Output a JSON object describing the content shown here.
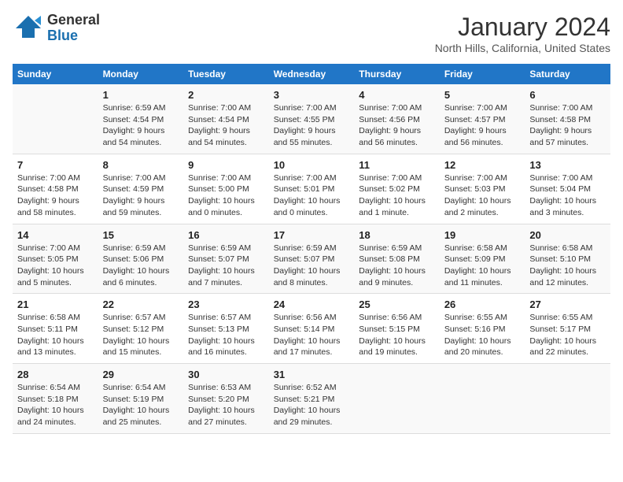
{
  "header": {
    "logo_line1": "General",
    "logo_line2": "Blue",
    "month_year": "January 2024",
    "location": "North Hills, California, United States"
  },
  "weekdays": [
    "Sunday",
    "Monday",
    "Tuesday",
    "Wednesday",
    "Thursday",
    "Friday",
    "Saturday"
  ],
  "weeks": [
    [
      {
        "day": "",
        "info": ""
      },
      {
        "day": "1",
        "info": "Sunrise: 6:59 AM\nSunset: 4:54 PM\nDaylight: 9 hours\nand 54 minutes."
      },
      {
        "day": "2",
        "info": "Sunrise: 7:00 AM\nSunset: 4:54 PM\nDaylight: 9 hours\nand 54 minutes."
      },
      {
        "day": "3",
        "info": "Sunrise: 7:00 AM\nSunset: 4:55 PM\nDaylight: 9 hours\nand 55 minutes."
      },
      {
        "day": "4",
        "info": "Sunrise: 7:00 AM\nSunset: 4:56 PM\nDaylight: 9 hours\nand 56 minutes."
      },
      {
        "day": "5",
        "info": "Sunrise: 7:00 AM\nSunset: 4:57 PM\nDaylight: 9 hours\nand 56 minutes."
      },
      {
        "day": "6",
        "info": "Sunrise: 7:00 AM\nSunset: 4:58 PM\nDaylight: 9 hours\nand 57 minutes."
      }
    ],
    [
      {
        "day": "7",
        "info": "Sunrise: 7:00 AM\nSunset: 4:58 PM\nDaylight: 9 hours\nand 58 minutes."
      },
      {
        "day": "8",
        "info": "Sunrise: 7:00 AM\nSunset: 4:59 PM\nDaylight: 9 hours\nand 59 minutes."
      },
      {
        "day": "9",
        "info": "Sunrise: 7:00 AM\nSunset: 5:00 PM\nDaylight: 10 hours\nand 0 minutes."
      },
      {
        "day": "10",
        "info": "Sunrise: 7:00 AM\nSunset: 5:01 PM\nDaylight: 10 hours\nand 0 minutes."
      },
      {
        "day": "11",
        "info": "Sunrise: 7:00 AM\nSunset: 5:02 PM\nDaylight: 10 hours\nand 1 minute."
      },
      {
        "day": "12",
        "info": "Sunrise: 7:00 AM\nSunset: 5:03 PM\nDaylight: 10 hours\nand 2 minutes."
      },
      {
        "day": "13",
        "info": "Sunrise: 7:00 AM\nSunset: 5:04 PM\nDaylight: 10 hours\nand 3 minutes."
      }
    ],
    [
      {
        "day": "14",
        "info": "Sunrise: 7:00 AM\nSunset: 5:05 PM\nDaylight: 10 hours\nand 5 minutes."
      },
      {
        "day": "15",
        "info": "Sunrise: 6:59 AM\nSunset: 5:06 PM\nDaylight: 10 hours\nand 6 minutes."
      },
      {
        "day": "16",
        "info": "Sunrise: 6:59 AM\nSunset: 5:07 PM\nDaylight: 10 hours\nand 7 minutes."
      },
      {
        "day": "17",
        "info": "Sunrise: 6:59 AM\nSunset: 5:07 PM\nDaylight: 10 hours\nand 8 minutes."
      },
      {
        "day": "18",
        "info": "Sunrise: 6:59 AM\nSunset: 5:08 PM\nDaylight: 10 hours\nand 9 minutes."
      },
      {
        "day": "19",
        "info": "Sunrise: 6:58 AM\nSunset: 5:09 PM\nDaylight: 10 hours\nand 11 minutes."
      },
      {
        "day": "20",
        "info": "Sunrise: 6:58 AM\nSunset: 5:10 PM\nDaylight: 10 hours\nand 12 minutes."
      }
    ],
    [
      {
        "day": "21",
        "info": "Sunrise: 6:58 AM\nSunset: 5:11 PM\nDaylight: 10 hours\nand 13 minutes."
      },
      {
        "day": "22",
        "info": "Sunrise: 6:57 AM\nSunset: 5:12 PM\nDaylight: 10 hours\nand 15 minutes."
      },
      {
        "day": "23",
        "info": "Sunrise: 6:57 AM\nSunset: 5:13 PM\nDaylight: 10 hours\nand 16 minutes."
      },
      {
        "day": "24",
        "info": "Sunrise: 6:56 AM\nSunset: 5:14 PM\nDaylight: 10 hours\nand 17 minutes."
      },
      {
        "day": "25",
        "info": "Sunrise: 6:56 AM\nSunset: 5:15 PM\nDaylight: 10 hours\nand 19 minutes."
      },
      {
        "day": "26",
        "info": "Sunrise: 6:55 AM\nSunset: 5:16 PM\nDaylight: 10 hours\nand 20 minutes."
      },
      {
        "day": "27",
        "info": "Sunrise: 6:55 AM\nSunset: 5:17 PM\nDaylight: 10 hours\nand 22 minutes."
      }
    ],
    [
      {
        "day": "28",
        "info": "Sunrise: 6:54 AM\nSunset: 5:18 PM\nDaylight: 10 hours\nand 24 minutes."
      },
      {
        "day": "29",
        "info": "Sunrise: 6:54 AM\nSunset: 5:19 PM\nDaylight: 10 hours\nand 25 minutes."
      },
      {
        "day": "30",
        "info": "Sunrise: 6:53 AM\nSunset: 5:20 PM\nDaylight: 10 hours\nand 27 minutes."
      },
      {
        "day": "31",
        "info": "Sunrise: 6:52 AM\nSunset: 5:21 PM\nDaylight: 10 hours\nand 29 minutes."
      },
      {
        "day": "",
        "info": ""
      },
      {
        "day": "",
        "info": ""
      },
      {
        "day": "",
        "info": ""
      }
    ]
  ]
}
